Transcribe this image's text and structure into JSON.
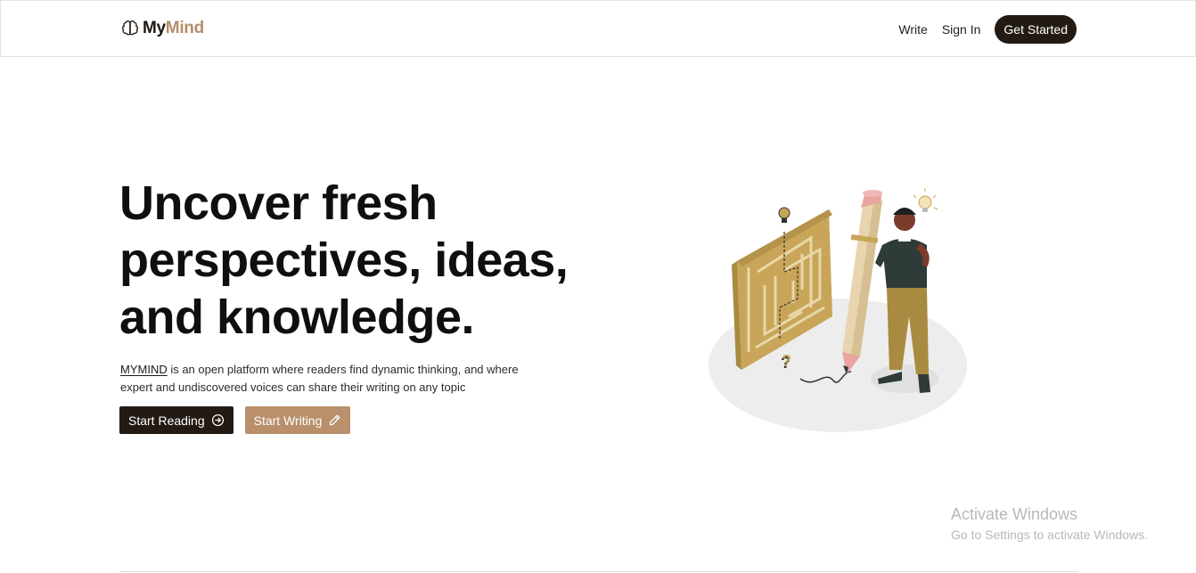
{
  "brand": {
    "name_part1": "My",
    "name_part2": "Mind",
    "icon": "brain-icon"
  },
  "nav": {
    "write": "Write",
    "sign_in": "Sign In",
    "get_started": "Get Started"
  },
  "hero": {
    "title": "Uncover fresh perspectives, ideas, and knowledge.",
    "brand_word": "MYMIND",
    "description": " is an open platform where readers find dynamic thinking, and where expert and undiscovered voices can share their writing on any topic",
    "start_reading": "Start Reading",
    "start_reading_icon": "arrow-circle-right-icon",
    "start_writing": "Start Writing",
    "start_writing_icon": "pencil-icon"
  },
  "watermark": {
    "title": "Activate Windows",
    "subtitle": "Go to Settings to activate Windows."
  },
  "colors": {
    "dark": "#221a13",
    "tan": "#b9906b",
    "brand_accent": "#b38d6a"
  }
}
